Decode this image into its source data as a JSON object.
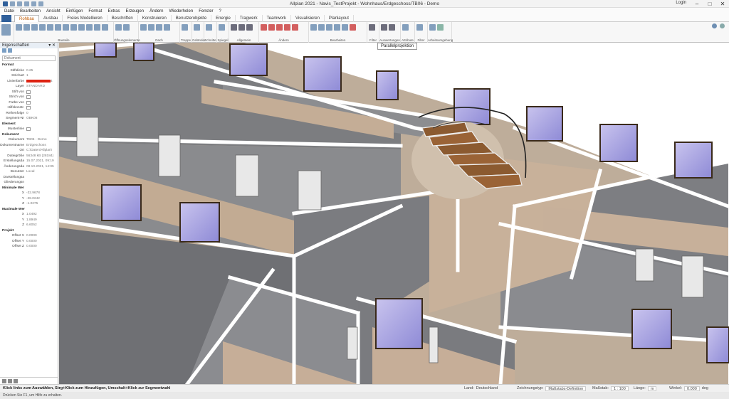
{
  "window": {
    "title": "Allplan 2021 - Navis_TestProjekt - Wohnhaus/Erdgeschoss/TB06 - Demo",
    "login": "Login"
  },
  "menu": [
    "Datei",
    "Bearbeiten",
    "Ansicht",
    "Einfügen",
    "Format",
    "Extras",
    "Erzeugen",
    "Ändern",
    "Wiederholen",
    "Fenster",
    "?"
  ],
  "tabs": [
    "Rohbau",
    "Ausbau",
    "Freies Modellieren",
    "Beschriften",
    "Konstruieren",
    "Benutzerobjekte",
    "Energie",
    "Tragwerk",
    "Teamwork",
    "Visualisieren",
    "Planlayout"
  ],
  "active_tab": "Rohbau",
  "ribbon_groups": [
    "Bauteile",
    "Öffnungselemente",
    "Dach",
    "Treppe",
    "Geländer",
    "Schnitte",
    "Spiegel",
    "Allgemein",
    "Ändern",
    "Bearbeiten",
    "Filter",
    "Auswertungen",
    "Attribute",
    "Filter",
    "Arbeitsumgebung"
  ],
  "tooltip": "Parallelprojektion",
  "properties": {
    "title": "Eigenschaften",
    "combo": "Dokument",
    "rows": [
      {
        "type": "sec",
        "label": "Format"
      },
      {
        "label": "Stiftdicke",
        "value": "0.25",
        "swatch": "line"
      },
      {
        "label": "Strichart",
        "value": "1",
        "swatch": "line"
      },
      {
        "label": "Linienfarbe",
        "value": "4",
        "swatch": "red"
      },
      {
        "label": "Layer",
        "value": "STANDARD"
      },
      {
        "label": "Stift von",
        "value": "",
        "swatch": "box"
      },
      {
        "label": "Strich von",
        "value": "",
        "swatch": "box"
      },
      {
        "label": "Farbe von",
        "value": "",
        "swatch": "box"
      },
      {
        "label": "Hilfskonstr.",
        "value": "",
        "swatch": "box"
      },
      {
        "label": "Reihenfolge",
        "value": "0"
      },
      {
        "label": "Segment-Nr",
        "value": "OBK08"
      },
      {
        "type": "sec",
        "label": "Element"
      },
      {
        "label": "Musterlinie",
        "value": "",
        "swatch": "box"
      },
      {
        "type": "sec",
        "label": "Dokument"
      },
      {
        "label": "Dokument",
        "value": "TB06 - Demo"
      },
      {
        "label": "Dokumentname",
        "value": "Erdgeschoss"
      },
      {
        "label": "Ort",
        "value": "C:\\Daten\\Allplan\\"
      },
      {
        "label": "Dateigröße",
        "value": "56348 kB (28184)"
      },
      {
        "label": "Erstellungsda",
        "value": "15.07.2021, 09:19"
      },
      {
        "label": "Änderungsda",
        "value": "08.10.2021, 14:05"
      },
      {
        "label": "Benutzer",
        "value": "Local"
      },
      {
        "label": "Darstellungsa",
        "value": ""
      },
      {
        "label": "Gliederungsn",
        "value": ""
      },
      {
        "type": "sec",
        "label": "Minimale Wer"
      },
      {
        "label": "X",
        "value": "-32.9678"
      },
      {
        "label": "Y",
        "value": "-28.0242"
      },
      {
        "label": "Z",
        "value": "-1.0275"
      },
      {
        "type": "sec",
        "label": "Maximale Wer"
      },
      {
        "label": "X",
        "value": "1.0492"
      },
      {
        "label": "Y",
        "value": "1.8949"
      },
      {
        "label": "Z",
        "value": "6.6052"
      },
      {
        "type": "sec",
        "label": "Projekt"
      },
      {
        "label": "Offset X",
        "value": "0.0000"
      },
      {
        "label": "Offset Y",
        "value": "0.0000"
      },
      {
        "label": "Offset Z",
        "value": "0.0000"
      }
    ]
  },
  "status": {
    "hint": "Klick links zum Auswählen, Strg+Klick zum Hinzufügen, Umschalt+Klick zur Segmentwahl",
    "land_label": "Land:",
    "land": "Deutschland",
    "zeichentyp_label": "Zeichnungstyp:",
    "zeichentyp": "Maßstabs-Definition",
    "massstab_label": "Maßstab:",
    "massstab": "1 : 100",
    "laenge_label": "Länge:",
    "laenge": "m",
    "winkel_label": "Winkel:",
    "winkel": "0.000",
    "winkel_unit": "deg"
  },
  "bottom_hint": "Drücken Sie F1, um Hilfe zu erhalten."
}
